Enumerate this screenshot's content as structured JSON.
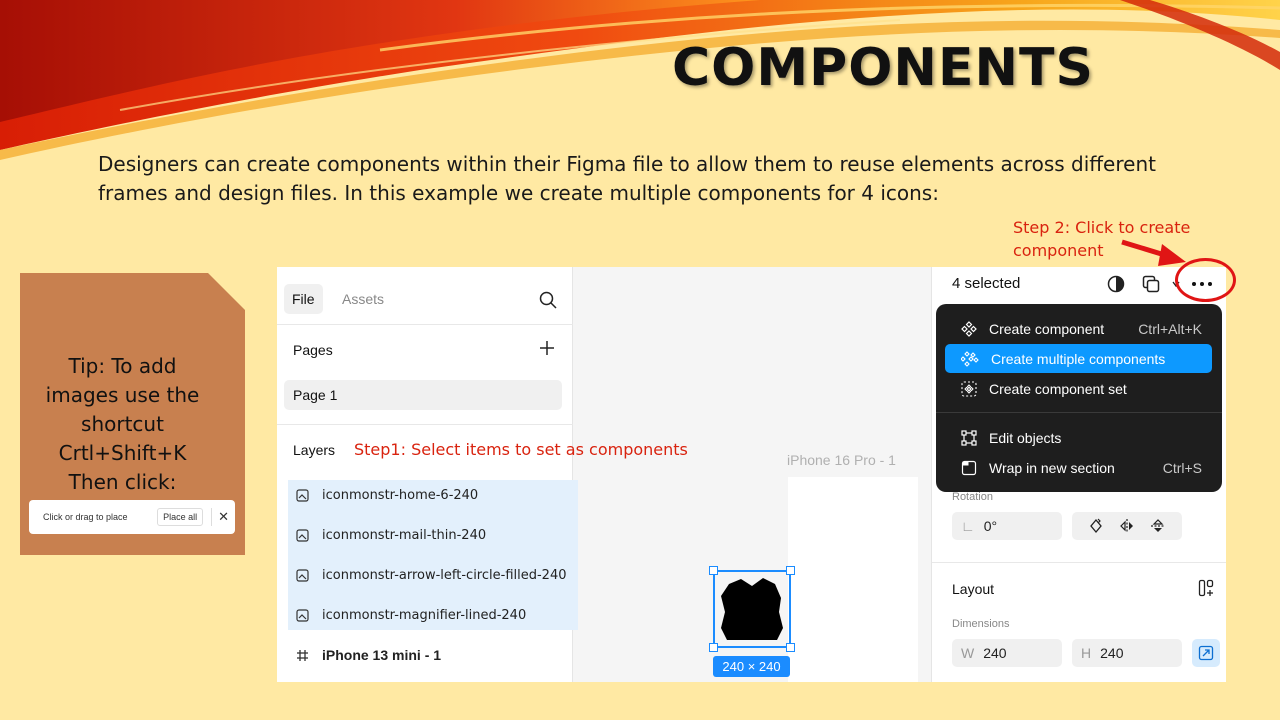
{
  "slide": {
    "title": "COMPONENTS",
    "intro": "Designers can create components within their Figma file to allow them to reuse elements across different frames and design files. In this example we create multiple components for 4 icons:",
    "step2_annotation": "Step 2: Click to create component",
    "step1_annotation": "Step1: Select items to set as components",
    "tip_lines": [
      "Tip: To add",
      "images use the",
      "shortcut",
      "Crtl+Shift+K",
      "Then click:"
    ],
    "place_toolbar": {
      "hint": "Click or drag to place",
      "button": "Place all",
      "close_icon": "close-icon"
    },
    "colors": {
      "background": "#ffe9a3",
      "annotation_red": "#d9230f",
      "tip_box": "#c8804f",
      "figma_blue": "#0d99ff"
    }
  },
  "figma": {
    "left_panel": {
      "tabs": [
        "File",
        "Assets"
      ],
      "search_icon": "search-icon",
      "pages_header": "Pages",
      "add_page_icon": "plus-icon",
      "pages": [
        "Page 1"
      ],
      "layers_header": "Layers",
      "layers": [
        {
          "name": "iconmonstr-home-6-240",
          "type": "image",
          "selected": true
        },
        {
          "name": "iconmonstr-mail-thin-240",
          "type": "image",
          "selected": true
        },
        {
          "name": "iconmonstr-arrow-left-circle-filled-240",
          "type": "image",
          "selected": true
        },
        {
          "name": "iconmonstr-magnifier-lined-240",
          "type": "image",
          "selected": true
        },
        {
          "name": "iPhone 13 mini - 1",
          "type": "frame",
          "selected": false
        }
      ]
    },
    "canvas": {
      "frame_label": "iPhone 16 Pro - 1",
      "selection_size": "240 × 240"
    },
    "right_panel": {
      "selection_count": "4 selected",
      "toolbar_icons": [
        "contrast-icon",
        "copy-icon",
        "more-icon"
      ],
      "menu": [
        {
          "label": "Create component",
          "shortcut": "Ctrl+Alt+K",
          "icon": "component-icon",
          "active": false
        },
        {
          "label": "Create multiple components",
          "shortcut": "",
          "icon": "multi-component-icon",
          "active": true
        },
        {
          "label": "Create component set",
          "shortcut": "",
          "icon": "component-set-icon",
          "active": false
        },
        {
          "label": "Edit objects",
          "shortcut": "",
          "icon": "edit-objects-icon",
          "active": false
        },
        {
          "label": "Wrap in new section",
          "shortcut": "Ctrl+S",
          "icon": "section-icon",
          "active": false
        }
      ],
      "rotation_label": "Rotation",
      "rotation_value": "0°",
      "layout_header": "Layout",
      "dimensions_label": "Dimensions",
      "width_prefix": "W",
      "width_value": "240",
      "height_prefix": "H",
      "height_value": "240"
    }
  }
}
